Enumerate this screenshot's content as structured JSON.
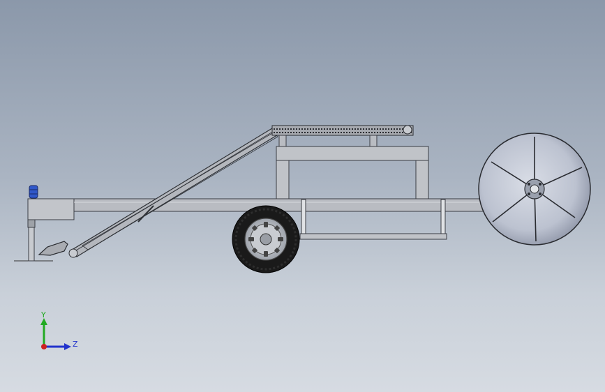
{
  "triad": {
    "y_label": "Y",
    "z_label": "Z",
    "y_color": "#22aa22",
    "z_color": "#2233cc",
    "x_color": "#cc2222"
  },
  "colors": {
    "frame_fill": "#b9bcc2",
    "frame_stroke": "#3a3d44",
    "tire": "#1a1a1a",
    "rim": "#bfc3c9",
    "disc_fill": "#c6cbd8",
    "disc_dark": "#5f6679",
    "cylinder": "#2f57c9"
  }
}
